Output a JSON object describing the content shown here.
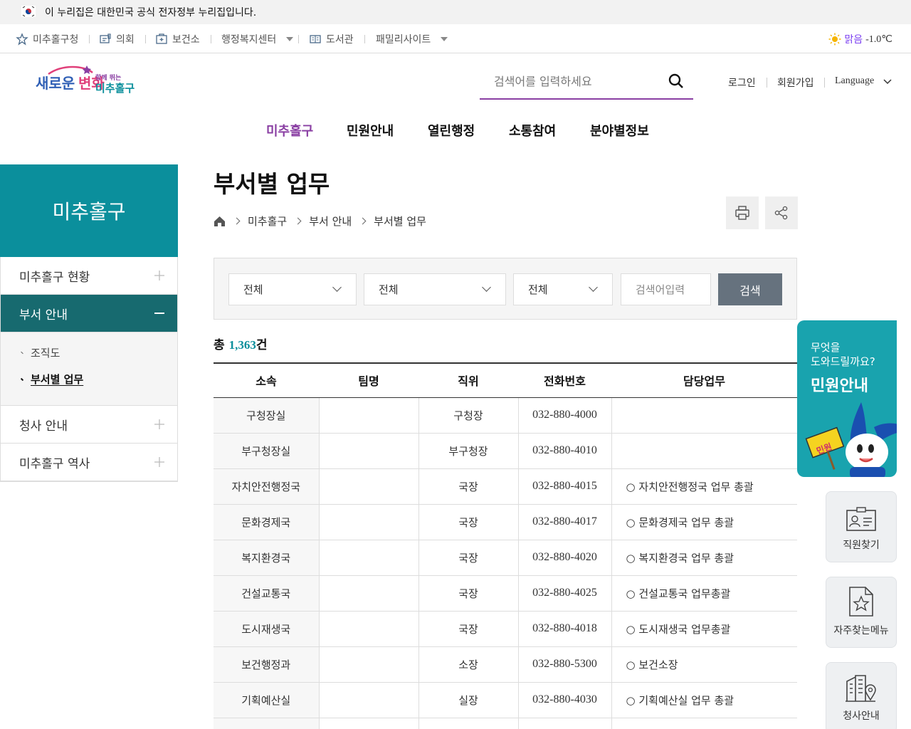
{
  "gov_banner": {
    "text": "이 누리집은 대한민국 공식 전자정부 누리집입니다."
  },
  "util_nav": {
    "items": [
      {
        "label": "미추홀구청",
        "icon": "star-icon"
      },
      {
        "label": "의회",
        "icon": "council-icon"
      },
      {
        "label": "보건소",
        "icon": "health-icon"
      },
      {
        "label": "행정복지센터",
        "icon": ""
      },
      {
        "label": "도서관",
        "icon": "book-icon"
      },
      {
        "label": "패밀리사이트",
        "icon": ""
      }
    ],
    "weather": {
      "icon": "sun-icon",
      "sky": "맑음",
      "temp": "-1.0℃"
    }
  },
  "header": {
    "logo_text": "새로운 변화 함께 뛰는 미추홀구",
    "search_placeholder": "검색어를 입력하세요",
    "login": "로그인",
    "signup": "회원가입",
    "language": "Language"
  },
  "gnb": [
    "미추홀구",
    "민원안내",
    "열린행정",
    "소통참여",
    "분야별정보"
  ],
  "sidebar": {
    "title": "미추홀구",
    "items": [
      {
        "label": "미추홀구 현황"
      },
      {
        "label": "부서 안내"
      },
      {
        "label": "청사 안내"
      },
      {
        "label": "미추홀구 역사"
      }
    ],
    "sub_items": [
      "조직도",
      "부서별 업무"
    ]
  },
  "page": {
    "title": "부서별 업무",
    "breadcrumb": [
      "미추홀구",
      "부서 안내",
      "부서별 업무"
    ]
  },
  "filter": {
    "selects": [
      "전체",
      "전체",
      "전체"
    ],
    "keyword_placeholder": "검색어입력",
    "search_label": "검색"
  },
  "total": {
    "prefix": "총 ",
    "count": "1,363",
    "suffix": "건"
  },
  "table": {
    "headers": [
      "소속",
      "팀명",
      "직위",
      "전화번호",
      "담당업무"
    ],
    "rows": [
      {
        "org": "구청장실",
        "team": "",
        "position": "구청장",
        "tel": "032-880-4000",
        "duty": ""
      },
      {
        "org": "부구청장실",
        "team": "",
        "position": "부구청장",
        "tel": "032-880-4010",
        "duty": ""
      },
      {
        "org": "자치안전행정국",
        "team": "",
        "position": "국장",
        "tel": "032-880-4015",
        "duty": "○ 자치안전행정국 업무 총괄"
      },
      {
        "org": "문화경제국",
        "team": "",
        "position": "국장",
        "tel": "032-880-4017",
        "duty": "○ 문화경제국 업무 총괄"
      },
      {
        "org": "복지환경국",
        "team": "",
        "position": "국장",
        "tel": "032-880-4020",
        "duty": "○ 복지환경국 업무 총괄"
      },
      {
        "org": "건설교통국",
        "team": "",
        "position": "국장",
        "tel": "032-880-4025",
        "duty": "○ 건설교통국 업무총괄"
      },
      {
        "org": "도시재생국",
        "team": "",
        "position": "국장",
        "tel": "032-880-4018",
        "duty": "○ 도시재생국 업무총괄"
      },
      {
        "org": "보건행정과",
        "team": "",
        "position": "소장",
        "tel": "032-880-5300",
        "duty": "○ 보건소장"
      },
      {
        "org": "기획예산실",
        "team": "",
        "position": "실장",
        "tel": "032-880-4030",
        "duty": "○ 기획예산실 업무 총괄"
      },
      {
        "org": "",
        "team": "",
        "position": "",
        "tel": "",
        "duty": ""
      }
    ]
  },
  "quick": {
    "main_line1": "무엇을",
    "main_line2": "도와드릴까요?",
    "main_title": "민원안내",
    "badge": "민원",
    "buttons": [
      "직원찾기",
      "자주찾는메뉴",
      "청사안내"
    ]
  }
}
